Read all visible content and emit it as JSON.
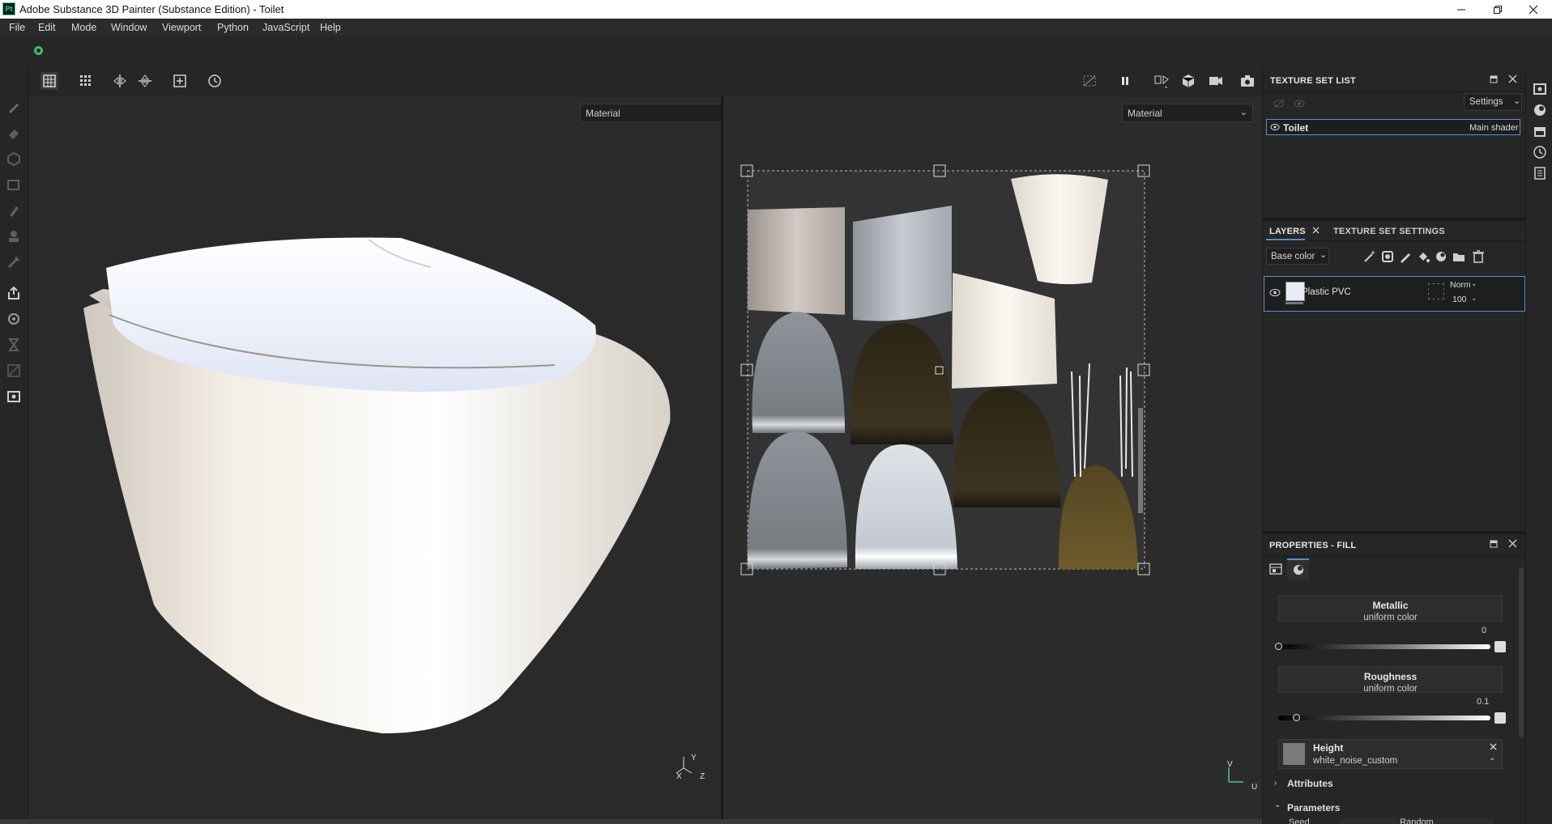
{
  "window": {
    "app_icon_text": "Pt",
    "title": "Adobe Substance 3D Painter (Substance Edition) - Toilet",
    "controls": [
      "minimize-icon",
      "restore-icon",
      "close-icon"
    ]
  },
  "menu": [
    "File",
    "Edit",
    "Mode",
    "Window",
    "Viewport",
    "Python",
    "JavaScript",
    "Help"
  ],
  "viewport": {
    "left_mode": "Material",
    "right_mode": "Material",
    "axis_3d": {
      "y": "Y",
      "x": "X",
      "z": "Z"
    },
    "axis_2d": {
      "v": "V",
      "u": "U"
    }
  },
  "texture_set_list": {
    "title": "TEXTURE SET LIST",
    "settings_label": "Settings",
    "items": [
      {
        "name": "Toilet",
        "shader": "Main shader"
      }
    ]
  },
  "layers": {
    "tab_layers": "LAYERS",
    "tab_texture_set_settings": "TEXTURE SET SETTINGS",
    "channel": "Base color",
    "items": [
      {
        "name": "Plastic PVC",
        "blend": "Norm",
        "opacity": "100"
      }
    ]
  },
  "properties": {
    "title": "PROPERTIES - FILL",
    "metallic": {
      "title": "Metallic",
      "source": "uniform color",
      "value": "0",
      "level": 0
    },
    "roughness": {
      "title": "Roughness",
      "source": "uniform color",
      "value": "0.1",
      "level": 0.1
    },
    "height": {
      "title": "Height",
      "source": "white_noise_custom"
    },
    "sections": {
      "attributes": "Attributes",
      "parameters": "Parameters"
    },
    "partial_row": {
      "label": "Seed",
      "value": "Random"
    }
  },
  "colors": {
    "accent_blue": "#5a8fd0",
    "panel_bg": "#262626",
    "viewport_bg": "#2a2a2a",
    "brand_green": "#3ebd6a"
  }
}
